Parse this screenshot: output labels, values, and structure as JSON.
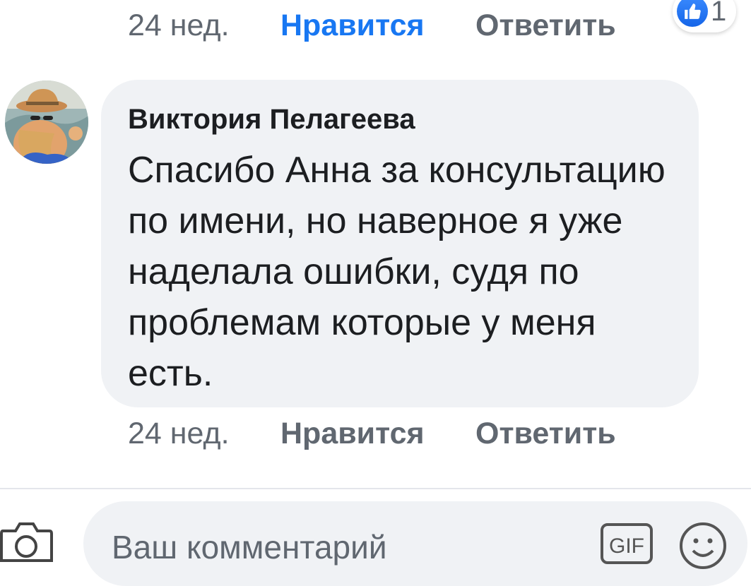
{
  "previous_comment": {
    "time": "24 нед.",
    "like_label": "Нравится",
    "reply_label": "Ответить",
    "reaction_count": "1",
    "reaction_icon": "thumbs-up-icon"
  },
  "comment": {
    "author": "Виктория Пелагеева",
    "text": "Спасибо Анна за консультацию по имени, но наверное я уже наделала ошибки, судя по проблемам которые у меня есть.",
    "time": "24 нед.",
    "like_label": "Нравится",
    "reply_label": "Ответить"
  },
  "composer": {
    "placeholder": "Ваш комментарий",
    "camera_icon": "camera-icon",
    "gif_icon": "gif-icon",
    "emoji_icon": "emoji-icon"
  },
  "colors": {
    "accent": "#1877f2",
    "secondary_text": "#606770",
    "bubble_bg": "#f0f2f5"
  }
}
